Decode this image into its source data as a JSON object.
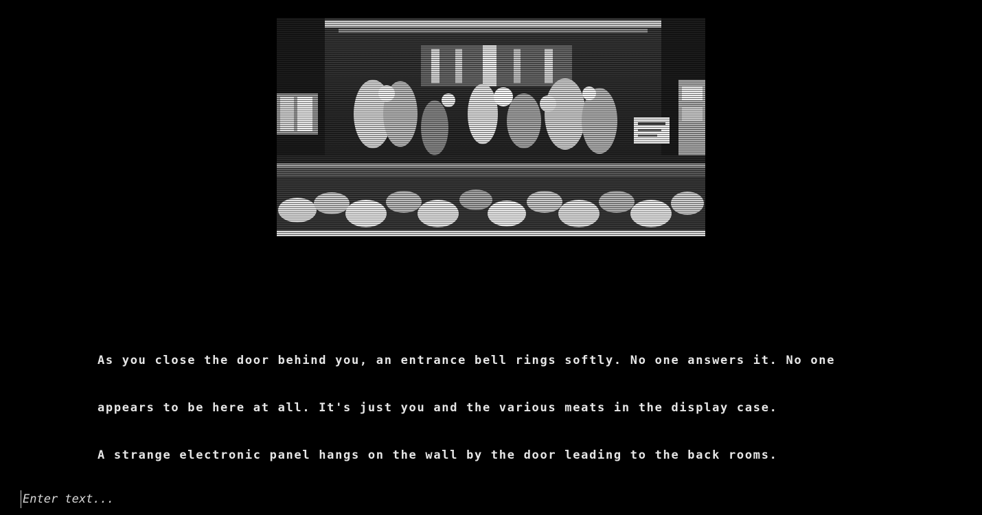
{
  "scene": {
    "image_description_icon": "butcher-shop-display-image"
  },
  "narration": {
    "lines": [
      "As you close the door behind you, an entrance bell rings softly. No one answers it. No one",
      "appears to be here at all. It's just you and the various meats in the display case.",
      "A strange electronic panel hangs on the wall by the door leading to the back rooms."
    ]
  },
  "command": {
    "placeholder": "Enter text...",
    "value": ""
  }
}
